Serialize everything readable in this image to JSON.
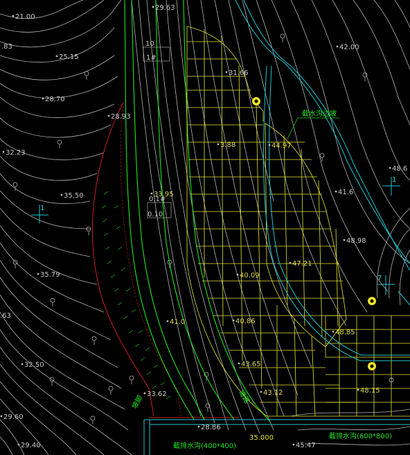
{
  "title": "",
  "elevations": [
    {
      "key": "e1",
      "text": "21.00"
    },
    {
      "key": "e2",
      "text": "29.63"
    },
    {
      "key": "e3",
      "text": ".83"
    },
    {
      "key": "e4",
      "text": "25.15"
    },
    {
      "key": "e5",
      "text": "42.00"
    },
    {
      "key": "e6",
      "text": "31.66"
    },
    {
      "key": "e7",
      "text": "28.70"
    },
    {
      "key": "e8",
      "text": "28.93"
    },
    {
      "key": "e9",
      "text": "32.23"
    },
    {
      "key": "e10",
      "text": "3.88"
    },
    {
      "key": "e11",
      "text": "44.97"
    },
    {
      "key": "e12",
      "text": "48.6"
    },
    {
      "key": "e13",
      "text": "35.50"
    },
    {
      "key": "e14",
      "text": "33.95"
    },
    {
      "key": "e15",
      "text": "41.6"
    },
    {
      "key": "e16",
      "text": "48.98"
    },
    {
      "key": "e17",
      "text": "35.79"
    },
    {
      "key": "e18",
      "text": "40.09"
    },
    {
      "key": "e19",
      "text": "47.21"
    },
    {
      "key": "e20",
      "text": ".63"
    },
    {
      "key": "e21",
      "text": "41.0"
    },
    {
      "key": "e22",
      "text": "40.86"
    },
    {
      "key": "e23",
      "text": "48.85"
    },
    {
      "key": "e24",
      "text": "32.50"
    },
    {
      "key": "e25",
      "text": "43.65"
    },
    {
      "key": "e26",
      "text": "33.62"
    },
    {
      "key": "e27",
      "text": "43.12"
    },
    {
      "key": "e28",
      "text": "48.15"
    },
    {
      "key": "e29",
      "text": "29.60"
    },
    {
      "key": "e30",
      "text": "28.86"
    },
    {
      "key": "e31",
      "text": "29.40"
    },
    {
      "key": "e32",
      "text": "45.47"
    }
  ],
  "annotations": {
    "upper_box_label": "10",
    "mid_box_label": "0.10",
    "slope_top_label": "1#",
    "slope_mid_label": "0.1#",
    "section_left": "1",
    "section_right": "1",
    "section_marker": "7",
    "green_label_top": "截水沟边坡",
    "green_label_road": "道路",
    "green_label_slope": "坡脚",
    "ditch_left": "截排水沟(400*400)",
    "ditch_elev": "35.000",
    "ditch_right": "截排水沟(600*800)"
  },
  "colors": {
    "contour": "#b4b4b4",
    "grid": "#e6e633",
    "road": "#1ed21e",
    "ditch": "#1ec8d2",
    "slope": "#c81e1e",
    "hatch": "#28c828",
    "marker": "#f0e628"
  }
}
